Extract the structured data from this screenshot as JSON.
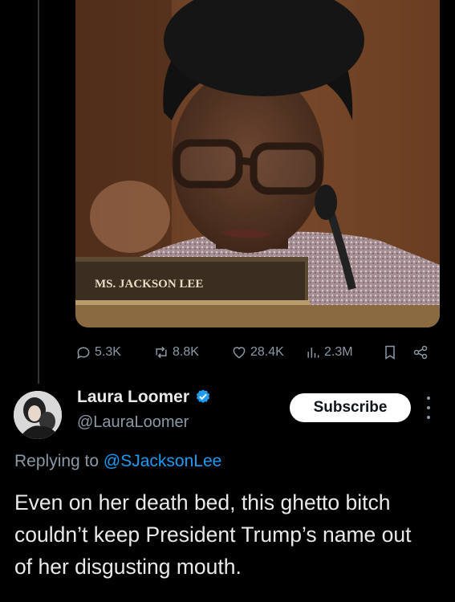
{
  "media": {
    "nameplate_text": "MS. JACKSON LEE"
  },
  "actions": {
    "replies": "5.3K",
    "reposts": "8.8K",
    "likes": "28.4K",
    "views": "2.3M"
  },
  "reply_tweet": {
    "author_name": "Laura Loomer",
    "handle": "@LauraLoomer",
    "subscribe_label": "Subscribe",
    "replying_prefix": "Replying to ",
    "replying_to": "@SJacksonLee",
    "text": "Even on her death bed, this ghetto bitch couldn’t keep President Trump’s name out of her disgusting mouth."
  },
  "colors": {
    "background": "#000000",
    "text_primary": "#e7e9ea",
    "text_secondary": "#8b98a5",
    "link": "#1d9bf0",
    "verified": "#1d9bf0"
  }
}
